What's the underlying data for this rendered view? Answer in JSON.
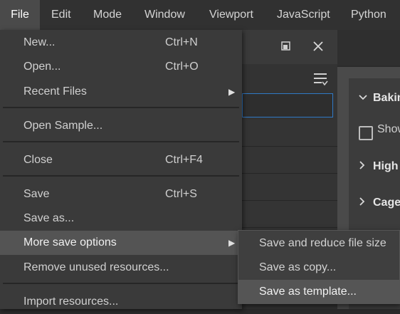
{
  "menubar": {
    "items": [
      {
        "label": "File"
      },
      {
        "label": "Edit"
      },
      {
        "label": "Mode"
      },
      {
        "label": "Window"
      },
      {
        "label": "Viewport"
      },
      {
        "label": "JavaScript"
      },
      {
        "label": "Python"
      }
    ],
    "active": "File"
  },
  "file_menu": {
    "items": [
      {
        "label": "New...",
        "shortcut": "Ctrl+N"
      },
      {
        "label": "Open...",
        "shortcut": "Ctrl+O"
      },
      {
        "label": "Recent Files",
        "has_submenu": true
      },
      {
        "label": "Open Sample..."
      },
      {
        "label": "Close",
        "shortcut": "Ctrl+F4"
      },
      {
        "label": "Save",
        "shortcut": "Ctrl+S"
      },
      {
        "label": "Save as..."
      },
      {
        "label": "More save options",
        "has_submenu": true,
        "highlighted": true
      },
      {
        "label": "Remove unused resources..."
      },
      {
        "label": "Import resources..."
      }
    ]
  },
  "save_submenu": {
    "items": [
      {
        "label": "Save and reduce file size"
      },
      {
        "label": "Save as copy..."
      },
      {
        "label": "Save as template...",
        "highlighted": true
      }
    ]
  },
  "background_panel": {
    "rows": [
      {
        "label": "Baking",
        "expanded": true
      },
      {
        "label": "Show",
        "checkbox": true
      },
      {
        "label": "High",
        "expanded": false
      },
      {
        "label": "Cage",
        "expanded": false
      }
    ]
  },
  "icons": {
    "restore": "restore-window-icon",
    "close": "close-icon",
    "filter": "filter-list-icon",
    "submenu_arrow": "triangle-right-icon"
  },
  "colors": {
    "menu_bg": "#3a3a3a",
    "highlight": "#545454",
    "accent_border": "#2f79c6"
  }
}
